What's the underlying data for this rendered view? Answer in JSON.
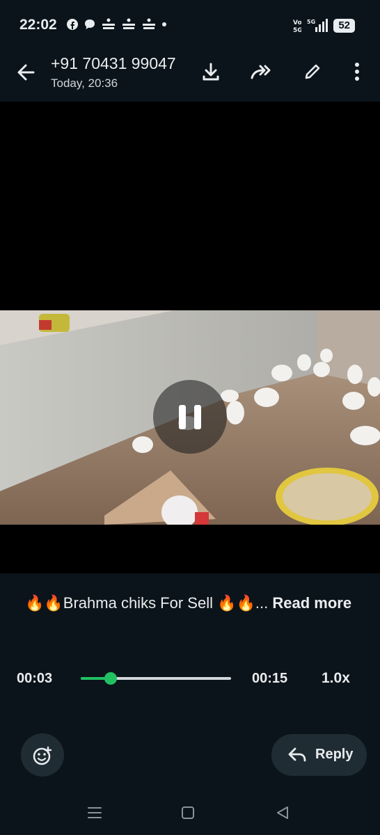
{
  "status_bar": {
    "time": "22:02",
    "icons": [
      "facebook-icon",
      "message-bubble-icon",
      "notification-icon",
      "notification-icon",
      "notification-icon",
      "dot-icon"
    ],
    "app_icon_text": "Ꮎ ",
    "network": "5G",
    "volte": "Vo\n5G",
    "battery": "52"
  },
  "header": {
    "contact": "+91 70431 99047",
    "timestamp": "Today, 20:36",
    "actions": [
      "download-icon",
      "forward-icon",
      "edit-icon",
      "more-icon"
    ]
  },
  "video": {
    "state": "playing",
    "control_icon": "pause-icon"
  },
  "caption": {
    "prefix_emoji": "🔥🔥",
    "text": "Brahma chiks For Sell ",
    "suffix_emoji": "🔥🔥",
    "ellipsis": "... ",
    "read_more": "Read more"
  },
  "playback": {
    "current": "00:03",
    "total": "00:15",
    "progress": 0.2,
    "speed": "1.0x"
  },
  "actions": {
    "emoji_icon": "emoji-add-icon",
    "reply_label": "Reply",
    "reply_icon": "reply-icon"
  },
  "colors": {
    "background": "#0b141a",
    "accent": "#21c063",
    "button_bg": "#1f2c33"
  }
}
